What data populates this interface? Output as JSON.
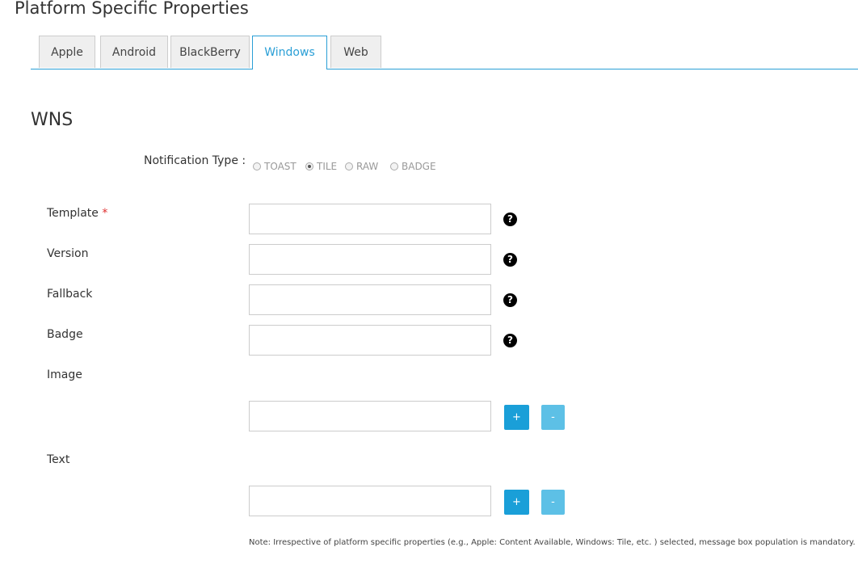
{
  "page": {
    "title": "Platform Specific Properties"
  },
  "tabs": [
    {
      "label": "Apple"
    },
    {
      "label": "Android"
    },
    {
      "label": "BlackBerry"
    },
    {
      "label": "Windows",
      "active": true
    },
    {
      "label": "Web"
    }
  ],
  "section": {
    "title": "WNS",
    "notification_type": {
      "label": "Notification Type :",
      "options": [
        {
          "label": "TOAST",
          "checked": false
        },
        {
          "label": "TILE",
          "checked": true
        },
        {
          "label": "RAW",
          "checked": false
        },
        {
          "label": "BADGE",
          "checked": false
        }
      ]
    },
    "fields": {
      "template": {
        "label": "Template",
        "required_mark": "*",
        "value": ""
      },
      "version": {
        "label": "Version",
        "value": ""
      },
      "fallback": {
        "label": "Fallback",
        "value": ""
      },
      "badge": {
        "label": "Badge",
        "value": ""
      },
      "image": {
        "label": "Image",
        "value": ""
      },
      "text": {
        "label": "Text",
        "value": ""
      }
    },
    "buttons": {
      "add": "+",
      "remove": "-"
    },
    "help_icon": "?",
    "note": "Note: Irrespective of platform specific properties (e.g., Apple: Content Available, Windows: Tile, etc. ) selected, message box population is mandatory."
  },
  "colors": {
    "accent": "#2a9fd6",
    "button": "#1a9fd8",
    "button_light": "#5dc0e6",
    "required": "#e03030"
  },
  "icons": {
    "help": "question-circle-icon"
  }
}
